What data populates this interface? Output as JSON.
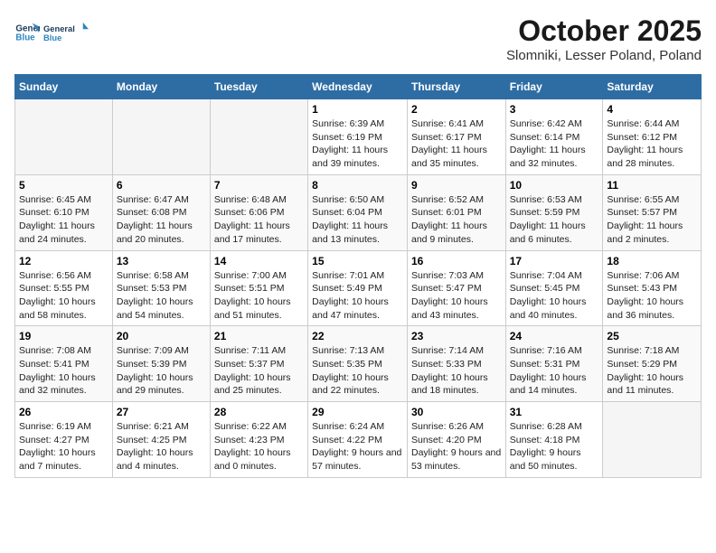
{
  "logo": {
    "line1": "General",
    "line2": "Blue"
  },
  "title": "October 2025",
  "location": "Slomniki, Lesser Poland, Poland",
  "days_of_week": [
    "Sunday",
    "Monday",
    "Tuesday",
    "Wednesday",
    "Thursday",
    "Friday",
    "Saturday"
  ],
  "weeks": [
    [
      {
        "day": "",
        "info": ""
      },
      {
        "day": "",
        "info": ""
      },
      {
        "day": "",
        "info": ""
      },
      {
        "day": "1",
        "info": "Sunrise: 6:39 AM\nSunset: 6:19 PM\nDaylight: 11 hours and 39 minutes."
      },
      {
        "day": "2",
        "info": "Sunrise: 6:41 AM\nSunset: 6:17 PM\nDaylight: 11 hours and 35 minutes."
      },
      {
        "day": "3",
        "info": "Sunrise: 6:42 AM\nSunset: 6:14 PM\nDaylight: 11 hours and 32 minutes."
      },
      {
        "day": "4",
        "info": "Sunrise: 6:44 AM\nSunset: 6:12 PM\nDaylight: 11 hours and 28 minutes."
      }
    ],
    [
      {
        "day": "5",
        "info": "Sunrise: 6:45 AM\nSunset: 6:10 PM\nDaylight: 11 hours and 24 minutes."
      },
      {
        "day": "6",
        "info": "Sunrise: 6:47 AM\nSunset: 6:08 PM\nDaylight: 11 hours and 20 minutes."
      },
      {
        "day": "7",
        "info": "Sunrise: 6:48 AM\nSunset: 6:06 PM\nDaylight: 11 hours and 17 minutes."
      },
      {
        "day": "8",
        "info": "Sunrise: 6:50 AM\nSunset: 6:04 PM\nDaylight: 11 hours and 13 minutes."
      },
      {
        "day": "9",
        "info": "Sunrise: 6:52 AM\nSunset: 6:01 PM\nDaylight: 11 hours and 9 minutes."
      },
      {
        "day": "10",
        "info": "Sunrise: 6:53 AM\nSunset: 5:59 PM\nDaylight: 11 hours and 6 minutes."
      },
      {
        "day": "11",
        "info": "Sunrise: 6:55 AM\nSunset: 5:57 PM\nDaylight: 11 hours and 2 minutes."
      }
    ],
    [
      {
        "day": "12",
        "info": "Sunrise: 6:56 AM\nSunset: 5:55 PM\nDaylight: 10 hours and 58 minutes."
      },
      {
        "day": "13",
        "info": "Sunrise: 6:58 AM\nSunset: 5:53 PM\nDaylight: 10 hours and 54 minutes."
      },
      {
        "day": "14",
        "info": "Sunrise: 7:00 AM\nSunset: 5:51 PM\nDaylight: 10 hours and 51 minutes."
      },
      {
        "day": "15",
        "info": "Sunrise: 7:01 AM\nSunset: 5:49 PM\nDaylight: 10 hours and 47 minutes."
      },
      {
        "day": "16",
        "info": "Sunrise: 7:03 AM\nSunset: 5:47 PM\nDaylight: 10 hours and 43 minutes."
      },
      {
        "day": "17",
        "info": "Sunrise: 7:04 AM\nSunset: 5:45 PM\nDaylight: 10 hours and 40 minutes."
      },
      {
        "day": "18",
        "info": "Sunrise: 7:06 AM\nSunset: 5:43 PM\nDaylight: 10 hours and 36 minutes."
      }
    ],
    [
      {
        "day": "19",
        "info": "Sunrise: 7:08 AM\nSunset: 5:41 PM\nDaylight: 10 hours and 32 minutes."
      },
      {
        "day": "20",
        "info": "Sunrise: 7:09 AM\nSunset: 5:39 PM\nDaylight: 10 hours and 29 minutes."
      },
      {
        "day": "21",
        "info": "Sunrise: 7:11 AM\nSunset: 5:37 PM\nDaylight: 10 hours and 25 minutes."
      },
      {
        "day": "22",
        "info": "Sunrise: 7:13 AM\nSunset: 5:35 PM\nDaylight: 10 hours and 22 minutes."
      },
      {
        "day": "23",
        "info": "Sunrise: 7:14 AM\nSunset: 5:33 PM\nDaylight: 10 hours and 18 minutes."
      },
      {
        "day": "24",
        "info": "Sunrise: 7:16 AM\nSunset: 5:31 PM\nDaylight: 10 hours and 14 minutes."
      },
      {
        "day": "25",
        "info": "Sunrise: 7:18 AM\nSunset: 5:29 PM\nDaylight: 10 hours and 11 minutes."
      }
    ],
    [
      {
        "day": "26",
        "info": "Sunrise: 6:19 AM\nSunset: 4:27 PM\nDaylight: 10 hours and 7 minutes."
      },
      {
        "day": "27",
        "info": "Sunrise: 6:21 AM\nSunset: 4:25 PM\nDaylight: 10 hours and 4 minutes."
      },
      {
        "day": "28",
        "info": "Sunrise: 6:22 AM\nSunset: 4:23 PM\nDaylight: 10 hours and 0 minutes."
      },
      {
        "day": "29",
        "info": "Sunrise: 6:24 AM\nSunset: 4:22 PM\nDaylight: 9 hours and 57 minutes."
      },
      {
        "day": "30",
        "info": "Sunrise: 6:26 AM\nSunset: 4:20 PM\nDaylight: 9 hours and 53 minutes."
      },
      {
        "day": "31",
        "info": "Sunrise: 6:28 AM\nSunset: 4:18 PM\nDaylight: 9 hours and 50 minutes."
      },
      {
        "day": "",
        "info": ""
      }
    ]
  ]
}
